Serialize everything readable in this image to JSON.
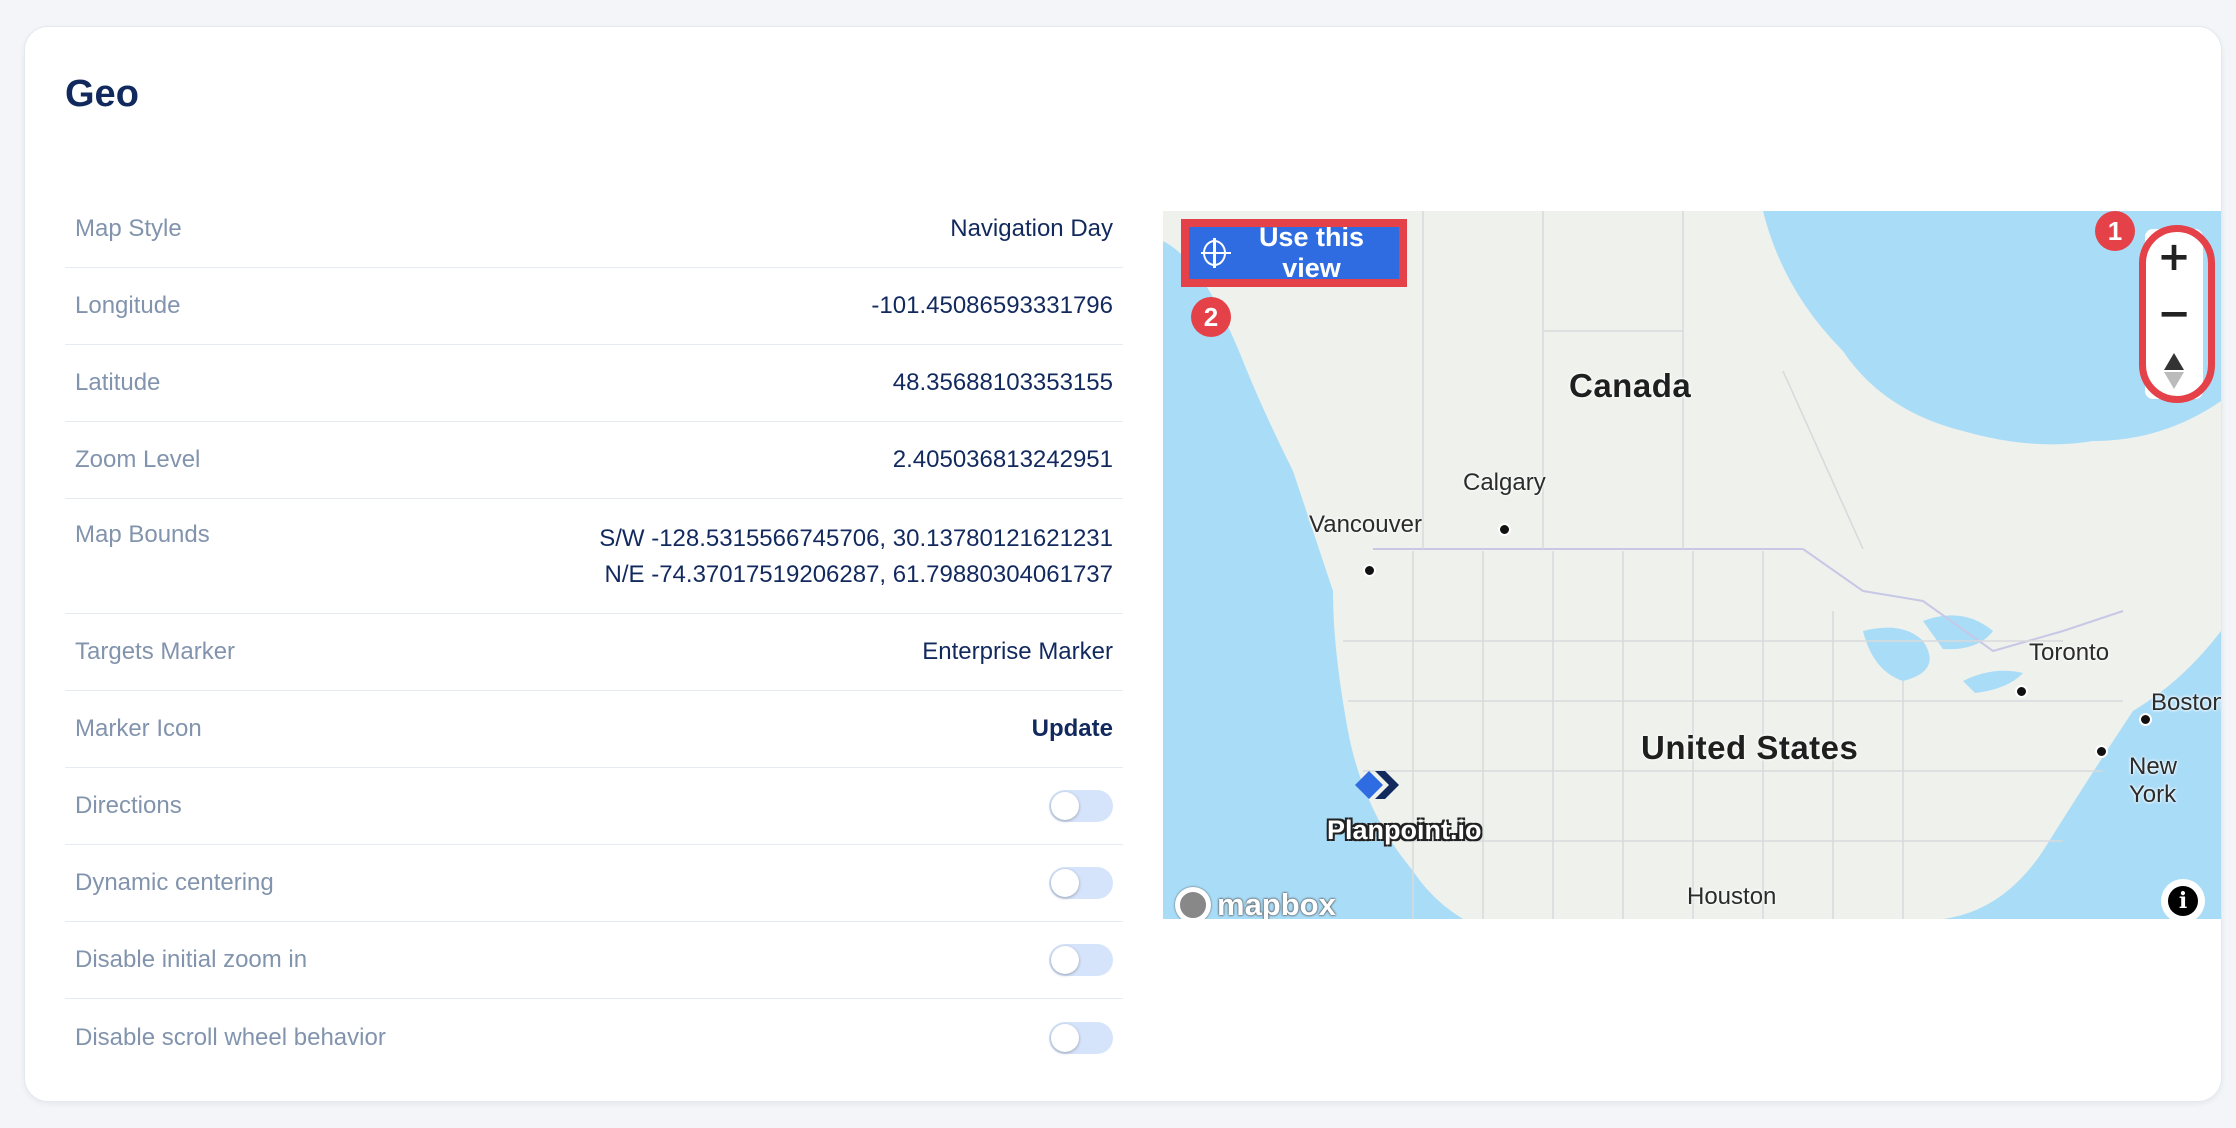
{
  "page": {
    "title": "Geo"
  },
  "settings": {
    "map_style": {
      "label": "Map Style",
      "value": "Navigation Day"
    },
    "longitude": {
      "label": "Longitude",
      "value": "-101.45086593331796"
    },
    "latitude": {
      "label": "Latitude",
      "value": "48.35688103353155"
    },
    "zoom_level": {
      "label": "Zoom Level",
      "value": "2.405036813242951"
    },
    "map_bounds": {
      "label": "Map Bounds",
      "sw": "S/W -128.5315566745706, 30.13780121621231",
      "ne": "N/E -74.37017519206287, 61.79880304061737"
    },
    "targets_marker": {
      "label": "Targets Marker",
      "value": "Enterprise Marker"
    },
    "marker_icon": {
      "label": "Marker Icon",
      "value": "Update"
    },
    "directions": {
      "label": "Directions",
      "enabled": false
    },
    "dynamic_centering": {
      "label": "Dynamic centering",
      "enabled": false
    },
    "disable_initial_zoom": {
      "label": "Disable initial zoom in",
      "enabled": false
    },
    "disable_scroll_wheel": {
      "label": "Disable scroll wheel behavior",
      "enabled": false
    }
  },
  "map": {
    "use_view_label": "Use this view",
    "zoom_in": "+",
    "zoom_out": "−",
    "labels": {
      "canada": "Canada",
      "united_states": "United States",
      "calgary": "Calgary",
      "vancouver": "Vancouver",
      "toronto": "Toronto",
      "boston": "Boston",
      "new_york": "New York",
      "houston": "Houston"
    },
    "marker_label": "Planpoint.io",
    "attribution": "mapbox",
    "info_symbol": "i",
    "annotation_badges": [
      "1",
      "2"
    ],
    "icons": {
      "crosshair": "crosshair-icon",
      "compass": "compass-icon",
      "info": "info-icon",
      "marker": "planpoint-marker-icon"
    }
  },
  "colors": {
    "title": "#12295e",
    "label": "#8294ad",
    "accent": "#2f6ce1",
    "annotation": "#e44148",
    "water": "#a9dcf7",
    "land": "#eef1ec"
  }
}
